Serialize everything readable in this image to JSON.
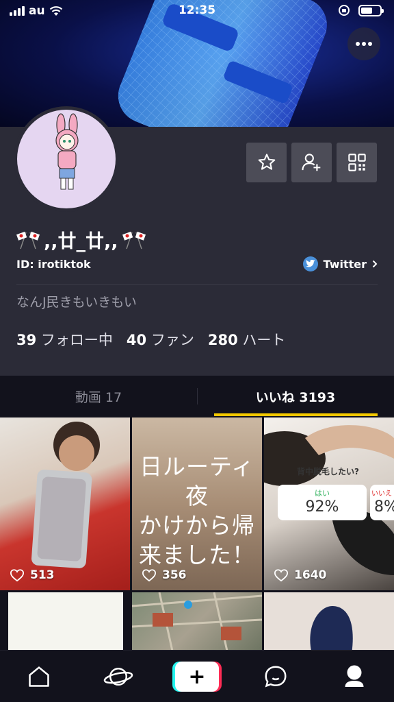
{
  "status_bar": {
    "carrier": "au",
    "time": "12:35"
  },
  "profile": {
    "display_name": ",,廿_廿,,",
    "user_id": "ID: irotiktok",
    "twitter_label": "Twitter",
    "bio": "なんJ民きもいきもい",
    "stats": {
      "following_count": "39",
      "following_label": "フォロー中",
      "fans_count": "40",
      "fans_label": "ファン",
      "hearts_count": "280",
      "hearts_label": "ハート"
    }
  },
  "tabs": {
    "videos": "動画 17",
    "likes": "いいね 3193"
  },
  "grid": [
    {
      "likes": "513"
    },
    {
      "likes": "356",
      "caption": [
        "日ルーティ",
        "夜",
        "かけから帰",
        "来ました！"
      ]
    },
    {
      "likes": "1640",
      "question": "背中脱毛したい?",
      "poll_yes": "はい",
      "poll_yes_pct": "92%",
      "poll_no": "いいえ",
      "poll_no_pct": "8%"
    }
  ],
  "icons": {
    "more": "more-dots-icon",
    "favorite": "star-icon",
    "add_friend": "add-user-icon",
    "qr": "qr-code-icon",
    "twitter": "twitter-bird-icon",
    "heart": "heart-outline-icon",
    "home": "home-icon",
    "discover": "planet-icon",
    "create": "plus-icon",
    "inbox": "chat-bubble-icon",
    "me": "profile-icon"
  },
  "colors": {
    "accent_tab": "#f2c700",
    "panel": "#2b2b37",
    "background": "#12121c",
    "twitter": "#4a90d9",
    "create_cyan": "#25f4ee",
    "create_red": "#fe2c55"
  }
}
